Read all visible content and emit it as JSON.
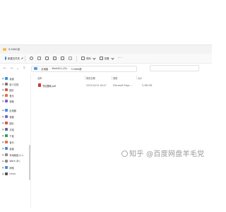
{
  "window": {
    "title": "5.5000页"
  },
  "toolbar": {
    "new_label": "新建文件夹",
    "sort_label": "排序",
    "view_label": "查看",
    "more_label": "···"
  },
  "address": {
    "crumbs": [
      "此电脑",
      "Work(D:) (D:)",
      "5.5000册"
    ]
  },
  "sidebar": {
    "items": [
      {
        "label": "桌面",
        "icon": "desktop-icon",
        "color": "#3d8be0"
      },
      {
        "label": "收人文档",
        "icon": "document-icon",
        "color": "#7a7a7a"
      },
      {
        "label": "图片",
        "icon": "picture-icon",
        "color": "#d9534f"
      },
      {
        "label": "音乐",
        "icon": "music-icon",
        "color": "#e0733d"
      },
      {
        "label": "视频",
        "icon": "video-icon",
        "color": "#7b5fd4"
      },
      {
        "label": "此电脑",
        "icon": "pc-icon",
        "color": "#3d8be0"
      },
      {
        "label": "视频",
        "icon": "video-icon",
        "color": "#7b5fd4"
      },
      {
        "label": "图片",
        "icon": "picture-icon",
        "color": "#d9534f"
      },
      {
        "label": "文档",
        "icon": "document-icon",
        "color": "#5a6f8a"
      },
      {
        "label": "下载",
        "icon": "download-icon",
        "color": "#2f9e5a"
      },
      {
        "label": "音乐",
        "icon": "music-icon",
        "color": "#e0733d"
      },
      {
        "label": "桌面",
        "icon": "desktop-icon",
        "color": "#3d8be0"
      },
      {
        "label": "本地磁盘 (C:)",
        "icon": "drive-icon",
        "color": "#8a8a8a"
      },
      {
        "label": "Work (D:)",
        "icon": "drive-icon",
        "color": "#8a8a8a"
      },
      {
        "label": "网络",
        "icon": "network-icon",
        "color": "#3d8be0"
      },
      {
        "label": "Linux",
        "icon": "linux-icon",
        "color": "#555555"
      }
    ]
  },
  "columns": [
    "名称",
    "修改日期",
    "类型",
    "大小"
  ],
  "files": [
    {
      "name": "书法基础.pdf",
      "date": "2023/10/14 18:47",
      "type": "Microsoft Edge ...",
      "size": "5,389 KB"
    }
  ],
  "watermark": "知乎 @百度网盘羊毛党"
}
